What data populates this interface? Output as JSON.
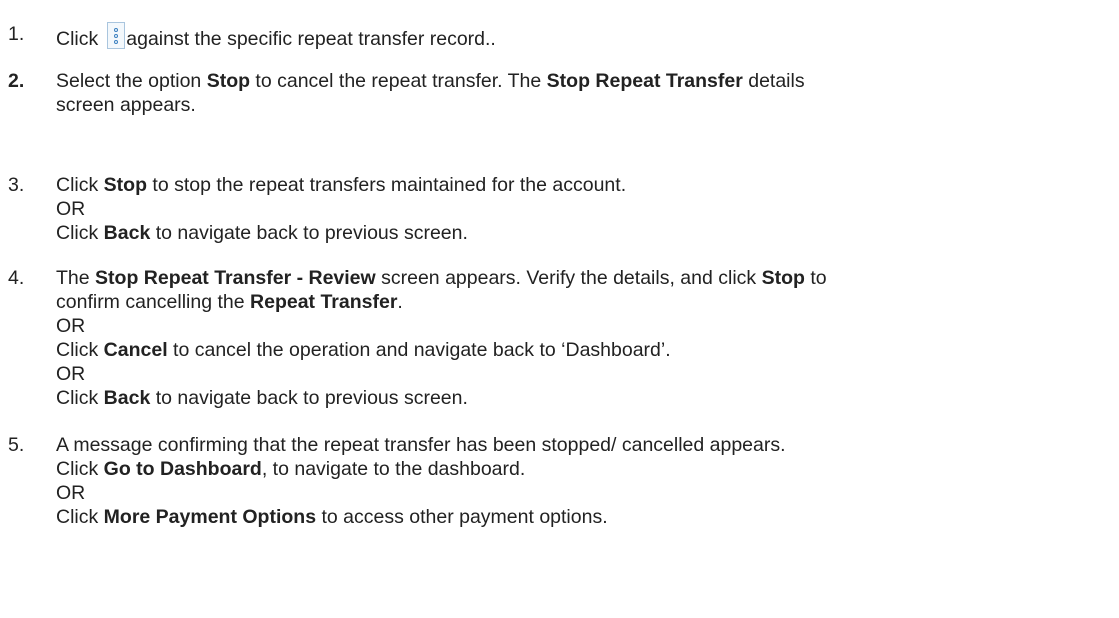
{
  "step1": {
    "number": "1.",
    "click": "Click",
    "rest": "against the specific repeat transfer record..",
    "icon": "kebab-menu-icon"
  },
  "step2": {
    "number": "2.",
    "p1": "Select the option ",
    "b1": "Stop",
    "p2": " to cancel the repeat transfer. The ",
    "b2": "Stop Repeat Transfer",
    "p3": " details",
    "p4": "screen appears."
  },
  "step3": {
    "number": "3.",
    "l1_a": "Click ",
    "l1_b": "Stop",
    "l1_c": " to stop the repeat transfers maintained for the account.",
    "or1": "OR",
    "l3_a": "Click ",
    "l3_b": "Back",
    "l3_c": " to navigate back to previous screen."
  },
  "step4": {
    "number": "4.",
    "l1_a": "The ",
    "l1_b": "Stop Repeat Transfer - Review",
    "l1_c": " screen appears. Verify the details, and click ",
    "l1_d": "Stop",
    "l1_e": " to",
    "l2_a": "confirm cancelling the ",
    "l2_b": "Repeat Transfer",
    "l2_c": ".",
    "or1": "OR",
    "l4_a": "Click ",
    "l4_b": "Cancel",
    "l4_c": " to cancel the operation and navigate back to ‘Dashboard’.",
    "or2": "OR",
    "l6_a": "Click ",
    "l6_b": "Back",
    "l6_c": " to navigate back to previous screen."
  },
  "step5": {
    "number": "5.",
    "l1": "A message confirming that the repeat transfer has been stopped/ cancelled appears.",
    "l2_a": "Click ",
    "l2_b": "Go to Dashboard",
    "l2_c": ", to navigate to the dashboard.",
    "or1": "OR",
    "l4_a": "Click ",
    "l4_b": "More Payment Options",
    "l4_c": " to access other payment options."
  }
}
